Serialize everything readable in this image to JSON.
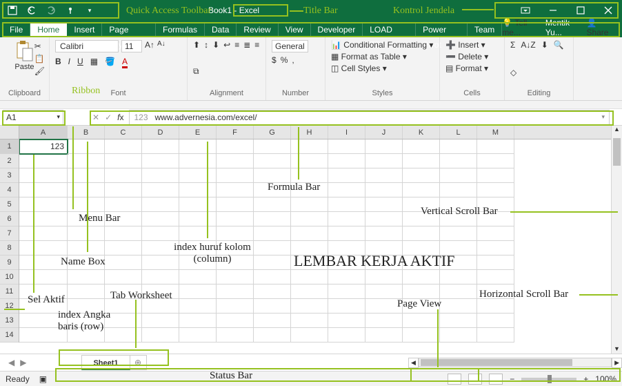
{
  "qat_label": "Quick Access Toolbar",
  "title": "Book1 - Excel",
  "title_label": "Title Bar",
  "win_label": "Kontrol Jendela",
  "tabs": [
    "File",
    "Home",
    "Insert",
    "Page Layout",
    "Formulas",
    "Data",
    "Review",
    "View",
    "Developer",
    "LOAD TEST",
    "Power Pivot",
    "Team"
  ],
  "tell_me": "Tell me...",
  "user": "Mentik Yu...",
  "share": "Share",
  "ribbon": {
    "label": "Ribbon",
    "clipboard": "Clipboard",
    "paste": "Paste",
    "font": "Font",
    "fontname": "Calibri",
    "fontsize": "11",
    "alignment": "Alignment",
    "number": "Number",
    "numfmt": "General",
    "styles": "Styles",
    "cf": "Conditional Formatting",
    "fat": "Format as Table",
    "cs": "Cell Styles",
    "cells": "Cells",
    "insert": "Insert",
    "delete": "Delete",
    "format": "Format",
    "editing": "Editing"
  },
  "namebox": "A1",
  "formula": "www.advernesia.com/excel/",
  "prefix": "123",
  "cols": [
    "A",
    "B",
    "C",
    "D",
    "E",
    "F",
    "G",
    "H",
    "I",
    "J",
    "K",
    "L",
    "M"
  ],
  "rows": [
    "1",
    "2",
    "3",
    "4",
    "5",
    "6",
    "7",
    "8",
    "9",
    "10",
    "11",
    "12",
    "13",
    "14"
  ],
  "cell_value": "123",
  "labels": {
    "formula_bar": "Formula Bar",
    "menu_bar": "Menu Bar",
    "name_box": "Name Box",
    "index_col": "index huruf kolom (column)",
    "big": "LEMBAR KERJA AKTIF",
    "sel_aktif": "Sel Aktif",
    "tab_ws": "Tab Worksheet",
    "index_row": "index Angka baris (row)",
    "page_view": "Page View",
    "hscroll": "Horizontal Scroll Bar",
    "vscroll": "Vertical Scroll Bar",
    "status_bar": "Status Bar"
  },
  "sheet": "Sheet1",
  "ready": "Ready",
  "zoom": "100%"
}
